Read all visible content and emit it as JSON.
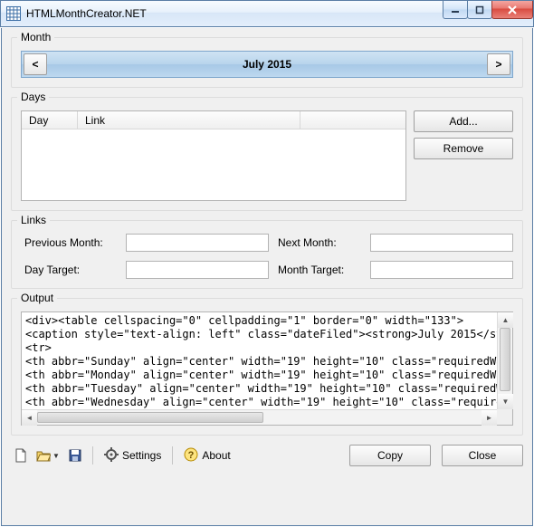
{
  "window": {
    "title": "HTMLMonthCreator.NET"
  },
  "month": {
    "group_label": "Month",
    "prev_glyph": "<",
    "next_glyph": ">",
    "current": "July 2015"
  },
  "days": {
    "group_label": "Days",
    "col_day": "Day",
    "col_link": "Link",
    "add_btn": "Add...",
    "remove_btn": "Remove"
  },
  "links": {
    "group_label": "Links",
    "prev_month_label": "Previous Month:",
    "next_month_label": "Next Month:",
    "day_target_label": "Day Target:",
    "month_target_label": "Month Target:",
    "prev_month_value": "",
    "next_month_value": "",
    "day_target_value": "",
    "month_target_value": ""
  },
  "output": {
    "group_label": "Output",
    "text": "<div><table cellspacing=\"0\" cellpadding=\"1\" border=\"0\" width=\"133\">\n<caption style=\"text-align: left\" class=\"dateFiled\"><strong>July 2015</strong></capti\n<tr>\n<th abbr=\"Sunday\" align=\"center\" width=\"19\" height=\"10\" class=\"requiredWarning\">S</th\n<th abbr=\"Monday\" align=\"center\" width=\"19\" height=\"10\" class=\"requiredWarning\">M</th\n<th abbr=\"Tuesday\" align=\"center\" width=\"19\" height=\"10\" class=\"requiredWarning\">T</t\n<th abbr=\"Wednesday\" align=\"center\" width=\"19\" height=\"10\" class=\"requiredWarning\">W<\n<th abbr=\"Thursday\" align=\"center\" width=\"19\" height=\"10\" class=\"requiredWarning\">T</\n<th abbr=\"Friday\" align=\"center\" width=\"19\" height=\"10\" class=\"requiredWarning\">F</th"
  },
  "toolbar": {
    "settings_label": "Settings",
    "about_label": "About",
    "copy_btn": "Copy",
    "close_btn": "Close"
  }
}
